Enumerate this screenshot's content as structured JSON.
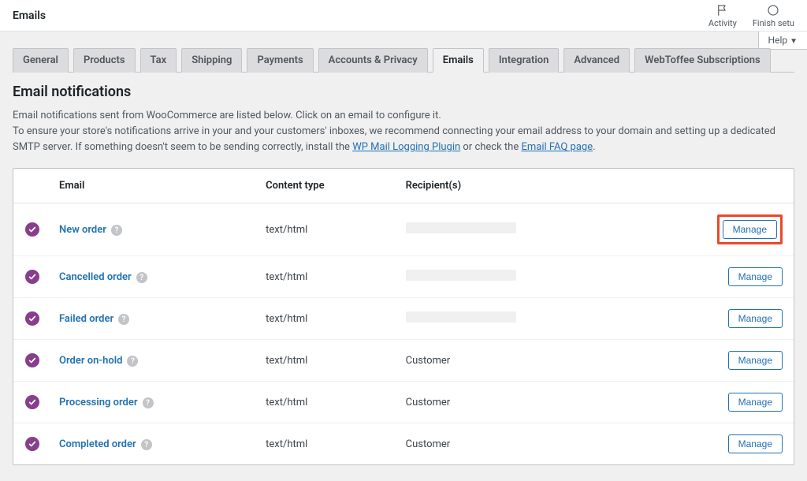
{
  "topbar": {
    "title": "Emails",
    "activity_label": "Activity",
    "finish_label": "Finish setu"
  },
  "help_tab_label": "Help",
  "tabs": [
    {
      "label": "General",
      "active": false
    },
    {
      "label": "Products",
      "active": false
    },
    {
      "label": "Tax",
      "active": false
    },
    {
      "label": "Shipping",
      "active": false
    },
    {
      "label": "Payments",
      "active": false
    },
    {
      "label": "Accounts & Privacy",
      "active": false
    },
    {
      "label": "Emails",
      "active": true
    },
    {
      "label": "Integration",
      "active": false
    },
    {
      "label": "Advanced",
      "active": false
    },
    {
      "label": "WebToffee Subscriptions",
      "active": false
    }
  ],
  "section": {
    "title": "Email notifications",
    "intro_line1": "Email notifications sent from WooCommerce are listed below. Click on an email to configure it.",
    "intro_line2a": "To ensure your store's notifications arrive in your and your customers' inboxes, we recommend connecting your email address to your domain and setting up a dedicated SMTP server. If something doesn't seem to be sending correctly, install the ",
    "link1": "WP Mail Logging Plugin",
    "intro_line2b": " or check the ",
    "link2": "Email FAQ page",
    "period": "."
  },
  "table": {
    "headers": {
      "email": "Email",
      "content_type": "Content type",
      "recipients": "Recipient(s)"
    },
    "manage_label": "Manage",
    "rows": [
      {
        "name": "New order",
        "content_type": "text/html",
        "recipient": "",
        "redacted": true,
        "highlight": true
      },
      {
        "name": "Cancelled order",
        "content_type": "text/html",
        "recipient": "",
        "redacted": true,
        "highlight": false
      },
      {
        "name": "Failed order",
        "content_type": "text/html",
        "recipient": "",
        "redacted": true,
        "highlight": false
      },
      {
        "name": "Order on-hold",
        "content_type": "text/html",
        "recipient": "Customer",
        "redacted": false,
        "highlight": false
      },
      {
        "name": "Processing order",
        "content_type": "text/html",
        "recipient": "Customer",
        "redacted": false,
        "highlight": false
      },
      {
        "name": "Completed order",
        "content_type": "text/html",
        "recipient": "Customer",
        "redacted": false,
        "highlight": false
      }
    ]
  }
}
